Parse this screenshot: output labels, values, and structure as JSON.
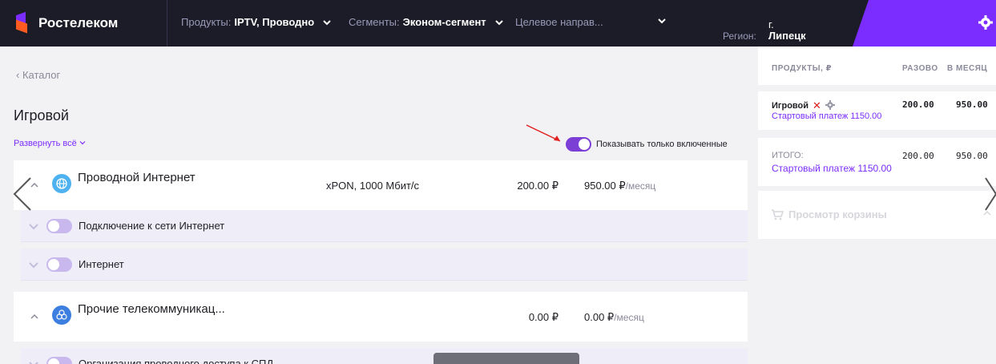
{
  "header": {
    "brand": "Ростелеком",
    "filters": [
      {
        "label": "Продукты:",
        "value": "IPTV,  Проводно"
      },
      {
        "label": "Сегменты:",
        "value": "Эконом-сегмент"
      },
      {
        "label": "",
        "value": "Целевое направ..."
      }
    ],
    "region_prefix": "г.",
    "region_label": "Регион:",
    "region_value": "Липецк",
    "accent_color": "#7b2cff"
  },
  "catalog": {
    "back_label": "Каталог",
    "title": "Игровой",
    "expand_all_label": "Развернуть всё",
    "show_only_enabled_label": "Показывать только включенные",
    "groups": [
      {
        "name": "Проводной Интернет",
        "icon": "globe-icon",
        "tech": "xPON, 1000 Мбит/с",
        "once": "200.00 ₽",
        "monthly": "950.00 ₽",
        "monthly_unit": "/месяц",
        "services": [
          "Подключение к сети Интернет",
          "Интернет"
        ]
      },
      {
        "name": "Прочие телекоммуникац...",
        "icon": "network-icon",
        "tech": "",
        "once": "0.00 ₽",
        "monthly": "0.00 ₽",
        "monthly_unit": "/месяц",
        "services": [
          "Организация проводного доступа к СПД"
        ]
      }
    ]
  },
  "cart": {
    "columns": [
      "ПРОДУКТЫ, ₽",
      "РАЗОВО",
      "В МЕСЯЦ"
    ],
    "item": {
      "name": "Игровой",
      "once": "200.00",
      "monthly": "950.00",
      "start_payment": "Стартовый платеж 1150.00"
    },
    "total": {
      "label": "ИТОГО:",
      "once": "200.00",
      "monthly": "950.00",
      "start_payment": "Стартовый платеж 1150.00"
    },
    "view_cart_label": "Просмотр корзины"
  }
}
